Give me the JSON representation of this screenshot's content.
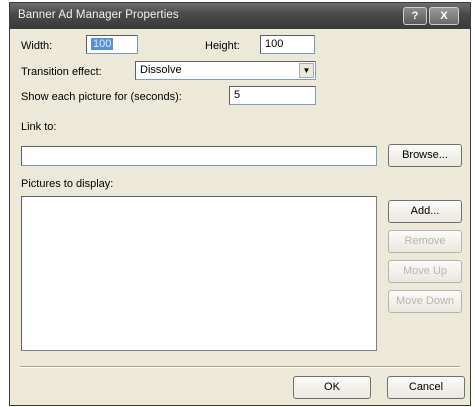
{
  "window": {
    "title": "Banner Ad Manager Properties",
    "help_glyph": "?",
    "close_glyph": "X"
  },
  "width": {
    "label": "Width:",
    "value": "100"
  },
  "height": {
    "label": "Height:",
    "value": "100"
  },
  "transition": {
    "label": "Transition effect:",
    "selected": "Dissolve",
    "arrow_glyph": "▼"
  },
  "show_each": {
    "label": "Show each picture for (seconds):",
    "value": "5"
  },
  "link": {
    "label": "Link to:",
    "value": "",
    "browse_label": "Browse..."
  },
  "pictures": {
    "label": "Pictures to display:",
    "items": [],
    "add_label": "Add...",
    "remove_label": "Remove",
    "move_up_label": "Move Up",
    "move_down_label": "Move Down"
  },
  "footer": {
    "ok_label": "OK",
    "cancel_label": "Cancel"
  }
}
